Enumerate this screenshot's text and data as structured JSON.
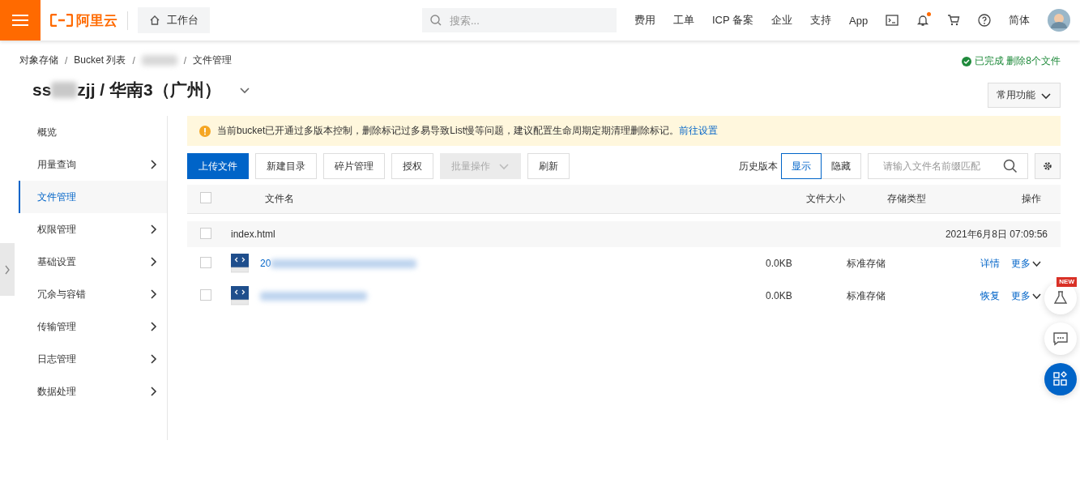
{
  "header": {
    "logo": "阿里云",
    "workbench": "工作台",
    "search": {
      "placeholder": "搜索..."
    },
    "nav": [
      "费用",
      "工单",
      "ICP 备案",
      "企业",
      "支持",
      "App"
    ],
    "icons": [
      {
        "kind": "terminal",
        "dot": false
      },
      {
        "kind": "bell",
        "dot": true
      },
      {
        "kind": "cart",
        "dot": false
      },
      {
        "kind": "help",
        "dot": false
      }
    ],
    "language": "简体"
  },
  "breadcrumb": [
    {
      "kind": "text",
      "label": "对象存储"
    },
    {
      "kind": "separator",
      "label": "/"
    },
    {
      "kind": "text",
      "label": "Bucket 列表"
    },
    {
      "kind": "separator",
      "label": "/"
    },
    {
      "kind": "redacted"
    },
    {
      "kind": "separator",
      "label": "/"
    },
    {
      "kind": "text",
      "label": "文件管理"
    }
  ],
  "task_status": "已完成 删除8个文件",
  "title": [
    {
      "kind": "text",
      "label": "ss"
    },
    {
      "kind": "redacted"
    },
    {
      "kind": "text",
      "label": "zjj / 华南3（广州）"
    }
  ],
  "common_functions": "常用功能",
  "sidebar": {
    "items": [
      {
        "label": "概览",
        "expandable": false,
        "selected": false
      },
      {
        "label": "用量查询",
        "expandable": true,
        "selected": false
      },
      {
        "label": "文件管理",
        "expandable": false,
        "selected": true
      },
      {
        "label": "权限管理",
        "expandable": true,
        "selected": false
      },
      {
        "label": "基础设置",
        "expandable": true,
        "selected": false
      },
      {
        "label": "冗余与容错",
        "expandable": true,
        "selected": false
      },
      {
        "label": "传输管理",
        "expandable": true,
        "selected": false
      },
      {
        "label": "日志管理",
        "expandable": true,
        "selected": false
      },
      {
        "label": "数据处理",
        "expandable": true,
        "selected": false
      }
    ]
  },
  "alert": {
    "text": "当前bucket已开通过多版本控制，删除标记过多易导致List慢等问题，建议配置生命周期定期清理删除标记。",
    "link": "前往设置"
  },
  "toolbar": {
    "buttons": [
      {
        "label": "上传文件",
        "kind": "primary",
        "disabled": false
      },
      {
        "label": "新建目录",
        "kind": "default",
        "disabled": false
      },
      {
        "label": "碎片管理",
        "kind": "default",
        "disabled": false
      },
      {
        "label": "授权",
        "kind": "default",
        "disabled": false
      },
      {
        "label": "批量操作",
        "kind": "dropdown",
        "disabled": true
      },
      {
        "label": "刷新",
        "kind": "default",
        "disabled": false
      }
    ],
    "history_label": "历史版本",
    "history_options": [
      {
        "label": "显示",
        "selected": true
      },
      {
        "label": "隐藏",
        "selected": false
      }
    ],
    "search": {
      "placeholder": "请输入文件名前缀匹配"
    }
  },
  "table": {
    "columns": [
      "文件名",
      "文件大小",
      "存储类型",
      "操作"
    ],
    "header_checked": false,
    "rows": [
      {
        "kind": "group",
        "checked": false,
        "name": "index.html",
        "modified": "2021年6月8日 07:09:56"
      },
      {
        "kind": "file",
        "checked": false,
        "name": "20",
        "redacted": true,
        "size": "0.0KB",
        "storage": "标准存储",
        "actions": [
          "详情",
          "更多"
        ]
      },
      {
        "kind": "file",
        "checked": false,
        "redacted": true,
        "size": "0.0KB",
        "storage": "标准存储",
        "actions": [
          "恢复",
          "更多"
        ]
      }
    ]
  },
  "float_buttons": [
    {
      "kind": "lab",
      "badge": "NEW"
    },
    {
      "kind": "chat"
    },
    {
      "kind": "apps"
    }
  ]
}
